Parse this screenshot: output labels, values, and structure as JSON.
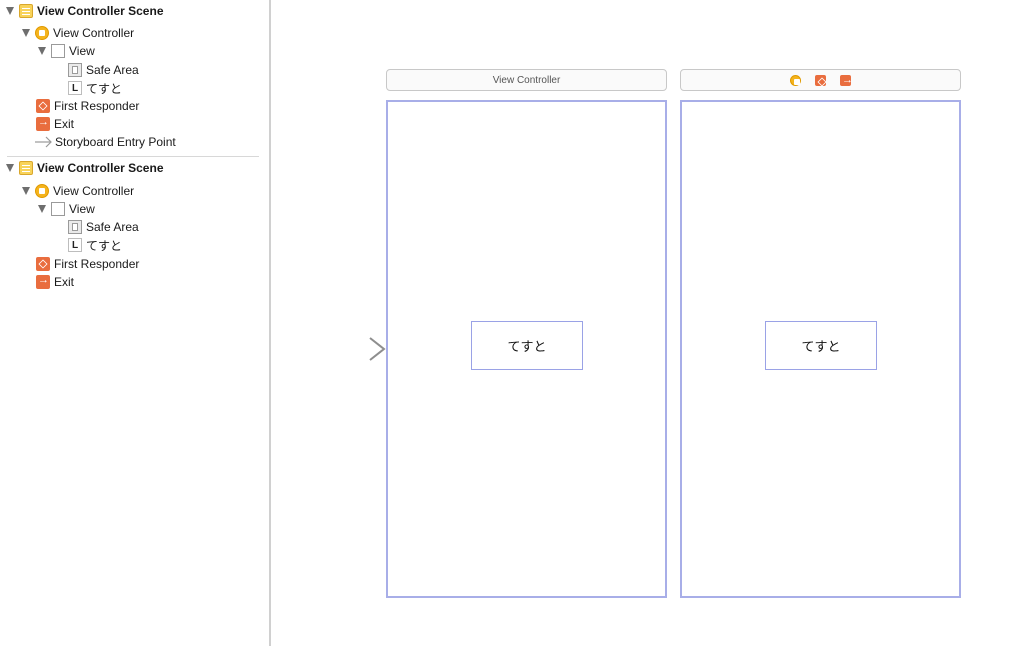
{
  "outline": {
    "scenes": [
      {
        "title": "View Controller Scene",
        "controller": "View Controller",
        "view": "View",
        "safe_area": "Safe Area",
        "label_item": "てすと",
        "first_responder": "First Responder",
        "exit": "Exit",
        "entry_point": "Storyboard Entry Point"
      },
      {
        "title": "View Controller Scene",
        "controller": "View Controller",
        "view": "View",
        "safe_area": "Safe Area",
        "label_item": "てすと",
        "first_responder": "First Responder",
        "exit": "Exit"
      }
    ]
  },
  "canvas": {
    "scene1": {
      "title": "View Controller",
      "label_text": "てすと"
    },
    "scene2": {
      "dock_icons": [
        "view-controller-icon",
        "first-responder-icon",
        "exit-icon"
      ],
      "label_text": "てすと"
    }
  },
  "colors": {
    "frame": "#a8aee8",
    "accent_orange": "#e96d3e",
    "accent_yellow": "#f5b41d"
  }
}
